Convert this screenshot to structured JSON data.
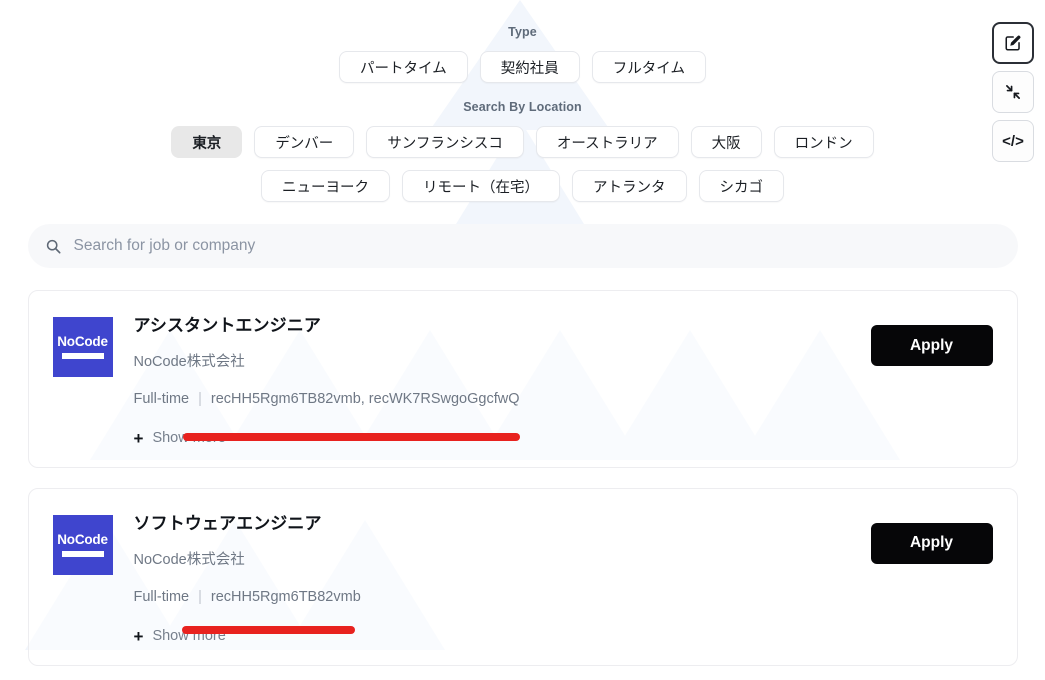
{
  "filters": {
    "type": {
      "label": "Type",
      "options": [
        {
          "label": "パートタイム",
          "selected": false
        },
        {
          "label": "契約社員",
          "selected": false
        },
        {
          "label": "フルタイム",
          "selected": false
        }
      ]
    },
    "location": {
      "label": "Search By Location",
      "row1": [
        {
          "label": "東京",
          "selected": true
        },
        {
          "label": "デンバー",
          "selected": false
        },
        {
          "label": "サンフランシスコ",
          "selected": false
        },
        {
          "label": "オーストラリア",
          "selected": false
        },
        {
          "label": "大阪",
          "selected": false
        },
        {
          "label": "ロンドン",
          "selected": false
        }
      ],
      "row2": [
        {
          "label": "ニューヨーク",
          "selected": false
        },
        {
          "label": "リモート（在宅）",
          "selected": false
        },
        {
          "label": "アトランタ",
          "selected": false
        },
        {
          "label": "シカゴ",
          "selected": false
        }
      ]
    }
  },
  "search": {
    "placeholder": "Search for job or company",
    "value": "",
    "icon": "search-icon"
  },
  "jobs": [
    {
      "logo_text": "NoCode",
      "title": "アシスタントエンジニア",
      "company": "NoCode株式会社",
      "employment_type": "Full-time",
      "separator": "|",
      "record_ids": "recHH5Rgm6TB82vmb, recWK7RSwgoGgcfwQ",
      "apply_label": "Apply",
      "show_more_label": "Show more",
      "show_more_icon": "plus-icon"
    },
    {
      "logo_text": "NoCode",
      "title": "ソフトウェアエンジニア",
      "company": "NoCode株式会社",
      "employment_type": "Full-time",
      "separator": "|",
      "record_ids": "recHH5Rgm6TB82vmb",
      "apply_label": "Apply",
      "show_more_label": "Show more",
      "show_more_icon": "plus-icon"
    }
  ],
  "toolbar": [
    {
      "icon": "edit-square-pencil-icon",
      "active": true
    },
    {
      "icon": "collapse-arrows-icon",
      "active": false
    },
    {
      "icon": "code-brackets-icon",
      "glyph": "</>",
      "active": false
    }
  ],
  "colors": {
    "logo_blue": "#3f45ce",
    "apply_black": "#060608",
    "annotation_red": "#e8221f",
    "chip_selected_bg": "#e8e8e8",
    "search_bg": "#f7f8fa"
  }
}
